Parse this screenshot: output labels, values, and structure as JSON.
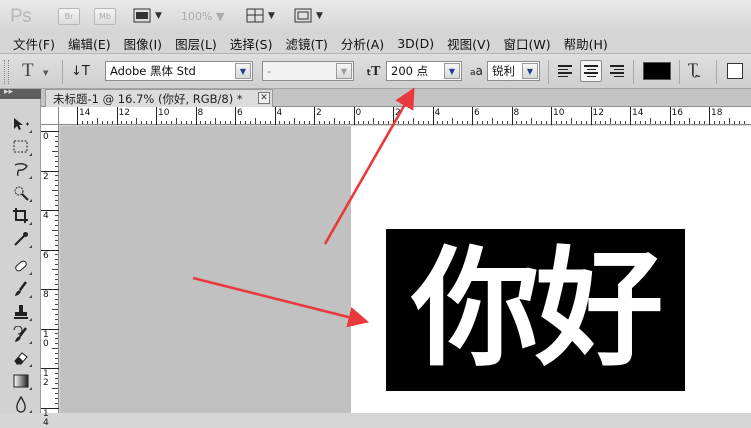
{
  "app": {
    "logo": "Ps",
    "bridge_label": "Br",
    "minibridge_label": "Mb",
    "zoom": "100%"
  },
  "menu": [
    "文件(F)",
    "编辑(E)",
    "图像(I)",
    "图层(L)",
    "选择(S)",
    "滤镜(T)",
    "分析(A)",
    "3D(D)",
    "视图(V)",
    "窗口(W)",
    "帮助(H)"
  ],
  "options": {
    "tool_glyph": "T",
    "font_family": "Adobe 黑体 Std",
    "font_style": "-",
    "font_size": "200 点",
    "aa_icon": "a",
    "antialias": "锐利",
    "text_color": "#000000"
  },
  "document": {
    "tab_title": "未标题-1 @ 16.7% (你好, RGB/8) *",
    "close_glyph": "✕",
    "layer_text": "你好"
  },
  "rulers": {
    "top": [
      "14",
      "12",
      "10",
      "8",
      "6",
      "4",
      "2",
      "0",
      "2",
      "4",
      "6",
      "8",
      "10",
      "12",
      "14",
      "16",
      "18"
    ],
    "left": [
      "0",
      "2",
      "4",
      "6",
      "8",
      "1\n0",
      "1\n2",
      "1\n4"
    ]
  },
  "colors": {
    "accent_arrow": "#e8393c",
    "pasteboard": "#c1c1c1"
  },
  "icons": {
    "toolbox": [
      "move-icon",
      "marquee-icon",
      "lasso-icon",
      "quick-select-icon",
      "crop-icon",
      "eyedropper-icon",
      "healing-icon",
      "brush-icon",
      "stamp-icon",
      "history-brush-icon",
      "eraser-icon",
      "gradient-icon",
      "blur-icon"
    ]
  }
}
